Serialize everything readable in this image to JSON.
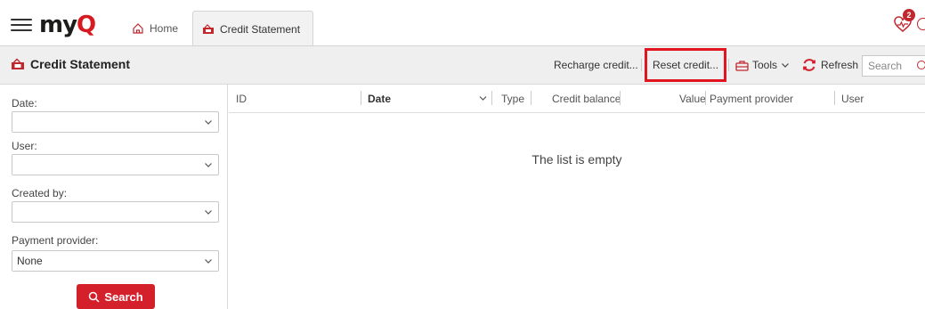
{
  "app": {
    "logo_text": "my",
    "logo_letter": "Q",
    "notification_count": "2"
  },
  "tabs": [
    {
      "label": "Home",
      "icon": "home-icon"
    },
    {
      "label": "Credit Statement",
      "icon": "credit-statement-icon"
    }
  ],
  "module": {
    "title": "Credit Statement"
  },
  "toolbar": {
    "recharge_label": "Recharge credit...",
    "reset_label": "Reset credit...",
    "tools_label": "Tools",
    "refresh_label": "Refresh",
    "search_placeholder": "Search",
    "highlight_color": "#e0151f"
  },
  "filters": {
    "date_label": "Date:",
    "date_value": "",
    "user_label": "User:",
    "user_value": "",
    "created_by_label": "Created by:",
    "created_by_value": "",
    "payment_provider_label": "Payment provider:",
    "payment_provider_value": "None",
    "search_button_label": "Search"
  },
  "grid": {
    "columns": [
      "ID",
      "Date",
      "Type",
      "Credit balance",
      "Value",
      "Payment provider",
      "User"
    ],
    "empty_message": "The list is empty"
  },
  "colors": {
    "brand_red": "#d4202b",
    "header_bg": "#efefef"
  }
}
